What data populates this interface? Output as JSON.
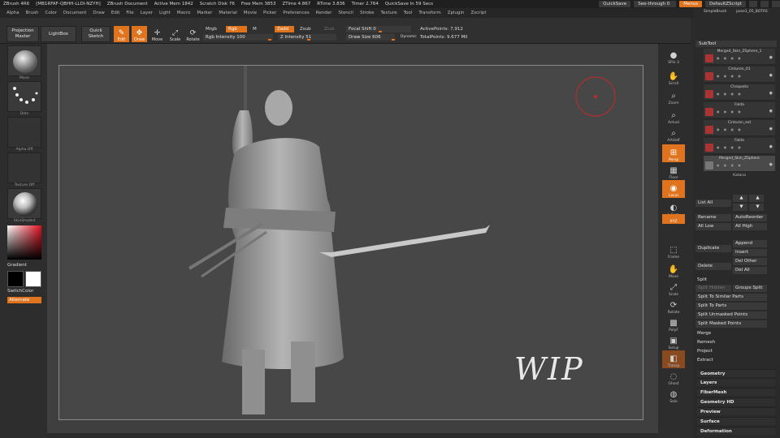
{
  "titlebar": {
    "app": "ZBrush 4R6",
    "session": "[MB1RFAF-QBHH-LLDI-NZYH]",
    "document": "ZBrush Document",
    "active_mem": "Active Mem 1842",
    "scratch_disk": "Scratch Disk 76",
    "free_mem": "Free Mem 3853",
    "ztime": "ZTime 4.867",
    "rtime": "RTime 3.836",
    "timer": "Timer 2.764",
    "quicksave_in": "QuickSave In 59 Secs",
    "quicksave_btn": "QuickSave",
    "see_through": "See-through 0",
    "menus_btn": "Menus",
    "script_btn": "DefaultZScript"
  },
  "menubar": [
    "Alpha",
    "Brush",
    "Color",
    "Document",
    "Draw",
    "Edit",
    "File",
    "Layer",
    "Light",
    "Macro",
    "Marker",
    "Material",
    "Movie",
    "Picker",
    "Preferences",
    "Render",
    "Stencil",
    "Stroke",
    "Texture",
    "Tool",
    "Transform",
    "Zplugin",
    "Zscript"
  ],
  "toolbar": {
    "projection_master": "Projection Master",
    "lightbox": "LightBox",
    "quick_sketch": "Quick Sketch",
    "tools": [
      {
        "label": "Edit",
        "icon": "edit-icon",
        "on": true
      },
      {
        "label": "Draw",
        "icon": "draw-icon",
        "on": true
      },
      {
        "label": "Move",
        "icon": "move-icon",
        "on": false
      },
      {
        "label": "Scale",
        "icon": "scale-icon",
        "on": false
      },
      {
        "label": "Rotate",
        "icon": "rotate-icon",
        "on": false
      }
    ],
    "mrgb": "Mrgb",
    "rgb": "Rgb",
    "m": "M",
    "zadd": "Zadd",
    "zsub": "Zsub",
    "zcut": "Zcut",
    "rgb_intensity": "Rgb Intensity 100",
    "z_intensity": "Z Intensity 51",
    "focal_shift": "Focal Shift 0",
    "draw_size": "Draw Size 606",
    "dynamic": "Dynamic",
    "active_points": "ActivePoints: 7,912",
    "total_points": "TotalPoints: 9.677 Mil"
  },
  "leftshelf": {
    "brush_label": "Move",
    "stroke_label": "Dots",
    "alpha_label": "Alpha Off",
    "texture_label": "Texture Off",
    "material_label": "SkinShade4",
    "gradient": "Gradient",
    "switch_color": "SwitchColor",
    "alternate": "Alternate"
  },
  "rightshelf": [
    {
      "label": "SPix 3",
      "icon": "spix-icon",
      "on": false
    },
    {
      "label": "Scroll",
      "icon": "scroll-icon",
      "on": false
    },
    {
      "label": "Zoom",
      "icon": "zoom-icon",
      "on": false
    },
    {
      "label": "Actual",
      "icon": "actual-icon",
      "on": false
    },
    {
      "label": "AAHalf",
      "icon": "aahalf-icon",
      "on": false
    },
    {
      "label": "Persp",
      "icon": "persp-icon",
      "on": true
    },
    {
      "label": "Floor",
      "icon": "floor-icon",
      "on": false
    },
    {
      "label": "Local",
      "icon": "local-icon",
      "on": true
    },
    {
      "label": "L.Sym",
      "icon": "lsym-icon",
      "on": false
    },
    {
      "label": "XYZ",
      "icon": "xyz-icon",
      "on": true
    },
    {
      "label": "Frame",
      "icon": "frame-icon",
      "on": false
    },
    {
      "label": "Move",
      "icon": "move-icon",
      "on": false
    },
    {
      "label": "Scale",
      "icon": "scale-icon",
      "on": false
    },
    {
      "label": "Rotate",
      "icon": "rotate-icon",
      "on": false
    },
    {
      "label": "PolyF",
      "icon": "polyf-icon",
      "on": false
    },
    {
      "label": "Setup",
      "icon": "setup-icon",
      "on": false
    },
    {
      "label": "Transp",
      "icon": "transp-icon",
      "on": false
    },
    {
      "label": "Ghost",
      "icon": "ghost-icon",
      "on": false
    },
    {
      "label": "Solo",
      "icon": "solo-icon",
      "on": false
    }
  ],
  "tray": {
    "tool_thumbs": [
      "SimpleBrush",
      "pose1_05_BOTAS"
    ],
    "subtool_title": "SubTool",
    "subtools": [
      "Merged_Skin_ZSphere_1",
      "Cinturon_01",
      "Chaqueta",
      "Falda",
      "Cinturon_ext",
      "Falda",
      "Merged_Skin_ZSphere"
    ],
    "subtool_bottom": "Katana",
    "list_all": "List All",
    "rename": "Rename",
    "auto_reorder": "AutoReorder",
    "all_low": "All Low",
    "all_high": "All High",
    "duplicate": "Duplicate",
    "append": "Append",
    "insert": "Insert",
    "delete": "Delete",
    "del_other": "Del Other",
    "del_all": "Del All",
    "split_title": "Split",
    "split_hidden": "Split Hidden",
    "groups_split": "Groups Split",
    "split_similar": "Split To Similar Parts",
    "split_parts": "Split To Parts",
    "split_unmasked": "Split Unmasked Points",
    "split_masked": "Split Masked Points",
    "merge": "Merge",
    "remesh": "Remesh",
    "project": "Project",
    "extract": "Extract"
  },
  "sections": [
    "Geometry",
    "Layers",
    "FiberMesh",
    "Geometry HD",
    "Preview",
    "Surface",
    "Deformation"
  ],
  "canvas": {
    "annotation": "WIP"
  },
  "colors": {
    "accent": "#e0731e",
    "cursor_ring": "#c42a2a"
  }
}
